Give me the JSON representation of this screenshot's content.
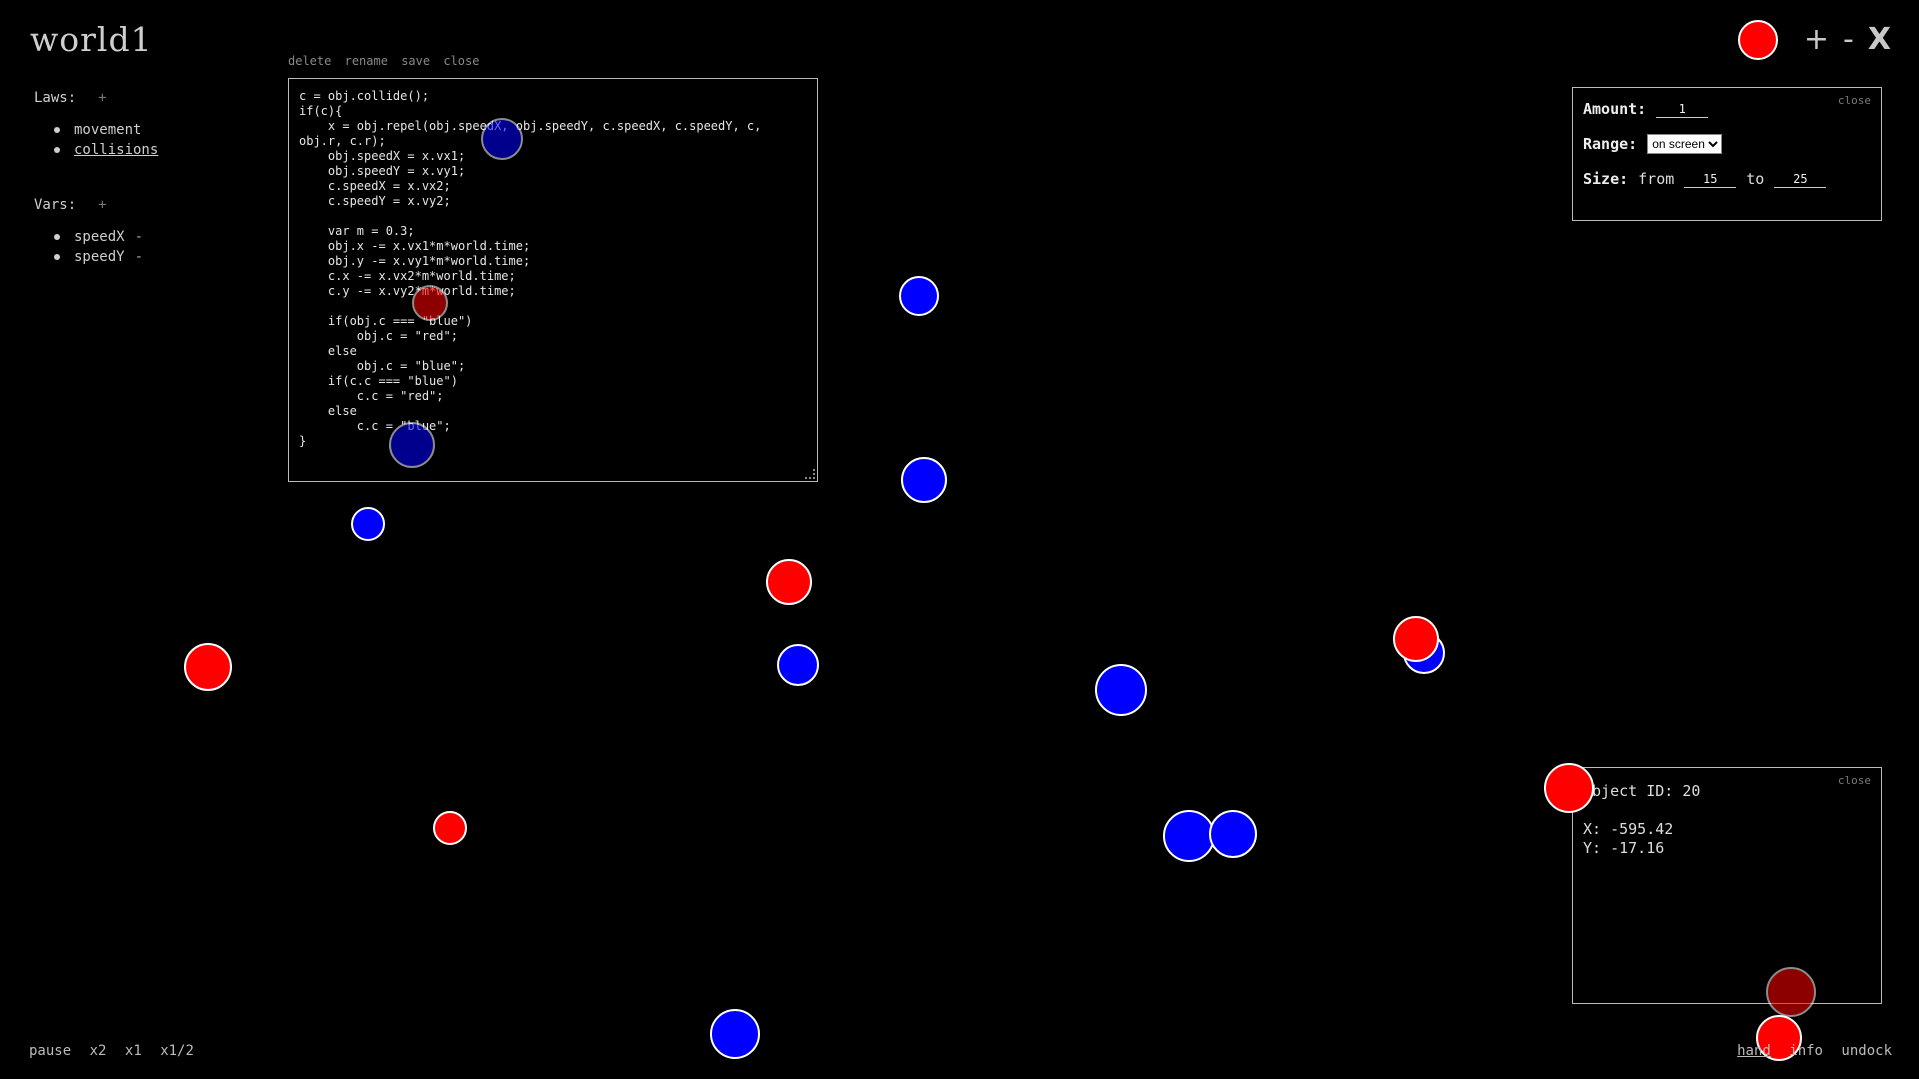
{
  "world": {
    "title": "world1"
  },
  "laws": {
    "label": "Laws:",
    "add": "+",
    "items": [
      "movement",
      "collisions"
    ]
  },
  "vars": {
    "label": "Vars:",
    "add": "+",
    "items": [
      {
        "name": "speedX",
        "remove": "-"
      },
      {
        "name": "speedY",
        "remove": "-"
      }
    ]
  },
  "editor": {
    "actions": [
      "delete",
      "rename",
      "save",
      "close"
    ],
    "code": "c = obj.collide();\nif(c){\n    x = obj.repel(obj.speedX, obj.speedY, c.speedX, c.speedY, c,\nobj.r, c.r);\n    obj.speedX = x.vx1;\n    obj.speedY = x.vy1;\n    c.speedX = x.vx2;\n    c.speedY = x.vy2;\n\n    var m = 0.3;\n    obj.x -= x.vx1*m*world.time;\n    obj.y -= x.vy1*m*world.time;\n    c.x -= x.vx2*m*world.time;\n    c.y -= x.vy2*m*world.time;\n\n    if(obj.c === \"blue\")\n        obj.c = \"red\";\n    else\n        obj.c = \"blue\";\n    if(c.c === \"blue\")\n        c.c = \"red\";\n    else\n        c.c = \"blue\";\n}"
  },
  "toolbar": {
    "add": "+",
    "remove": "-",
    "close": "X",
    "color": "#ff0000"
  },
  "spawn_panel": {
    "close": "close",
    "amount_label": "Amount:",
    "amount": "1",
    "range_label": "Range:",
    "range_value": "on screen",
    "size_label": "Size:",
    "from_label": "from",
    "size_from": "15",
    "to_label": "to",
    "size_to": "25"
  },
  "info_panel": {
    "close": "close",
    "object_id": "Object ID: 20",
    "x": "X: -595.42",
    "y": "Y: -17.16"
  },
  "playback": [
    "pause",
    "x2",
    "x1",
    "x1/2"
  ],
  "bottom_tools": [
    "hand",
    "info",
    "undock"
  ],
  "colors": {
    "red": "#ff0000",
    "blue": "#0000ff",
    "background": "#000000"
  }
}
